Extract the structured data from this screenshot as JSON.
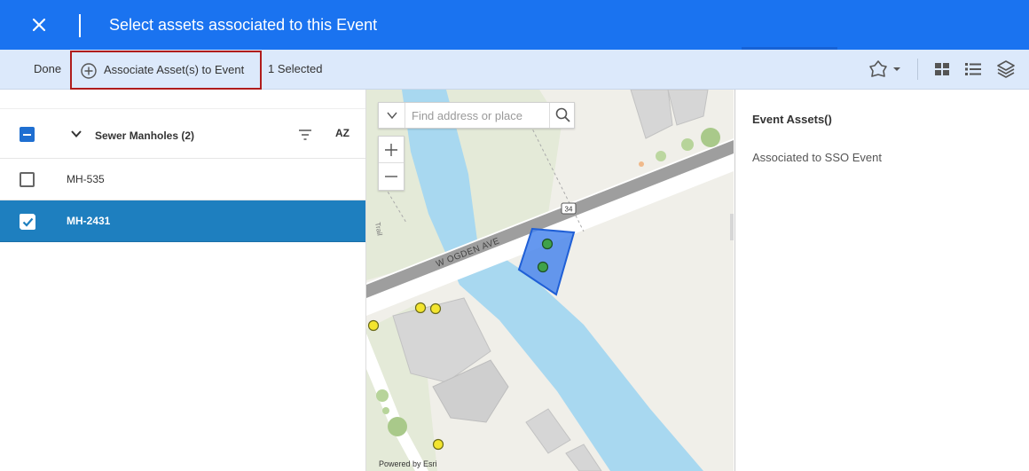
{
  "header": {
    "title": "Select assets associated to this Event",
    "accent": "#1a73f0"
  },
  "toolbar": {
    "done_label": "Done",
    "associate_label": "Associate Asset(s) to Event",
    "selected_count": "1 Selected"
  },
  "asset_list": {
    "group_label": "Sewer Manholes (2)",
    "sort_label": "AZ",
    "items": [
      {
        "label": "MH-535",
        "checked": false
      },
      {
        "label": "MH-2431",
        "checked": true
      }
    ]
  },
  "map": {
    "search_placeholder": "Find address or place",
    "street_label": "W OGDEN AVE",
    "route_shield": "34",
    "trail_label": "Trail",
    "attribution": "Powered by Esri",
    "selection_color": "#4a86ec"
  },
  "event_panel": {
    "title": "Event Assets()",
    "subtitle": "Associated to SSO Event"
  }
}
